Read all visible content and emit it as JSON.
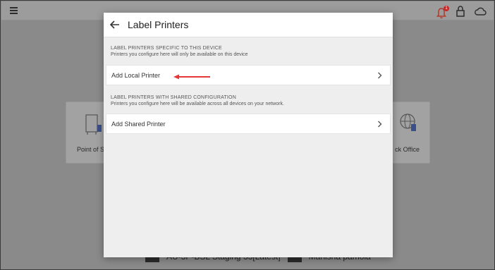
{
  "background": {
    "cards": [
      {
        "label": "Point of S"
      },
      {
        "label": "ck Office"
      }
    ],
    "footer": {
      "store": "AU-3P-BSL Staging 33[Latest]",
      "user": "Manisha pamola"
    },
    "notification_count": "1"
  },
  "dialog": {
    "title": "Label Printers",
    "sections": [
      {
        "title": "LABEL PRINTERS SPECIFIC TO THIS DEVICE",
        "subtitle": "Printers you configure here will only be available on this device",
        "action": "Add Local Printer"
      },
      {
        "title": "LABEL PRINTERS WITH SHARED CONFIGURATION",
        "subtitle": "Printers you configure here will be available across all devices on your network.",
        "action": "Add Shared Printer"
      }
    ]
  },
  "colors": {
    "annotation_arrow": "#e53935",
    "notification": "#c62828",
    "overlay_bg": "#8a8a8a"
  },
  "icons": [
    "menu-icon",
    "bell-icon",
    "lock-icon",
    "cloud-icon",
    "back-arrow-icon",
    "chevron-right-icon"
  ]
}
